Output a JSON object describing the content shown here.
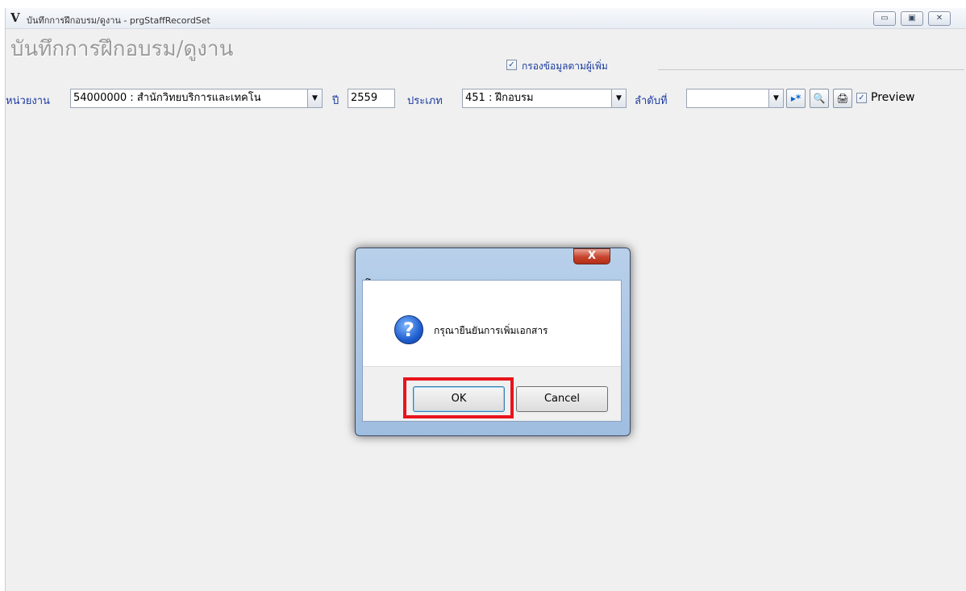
{
  "window": {
    "title": "บันทึกการฝึกอบรม/ดูงาน - prgStaffRecordSet",
    "app_icon_glyph": "V",
    "minimize_glyph": "▭",
    "maximize_glyph": "▣",
    "close_glyph": "✕"
  },
  "page": {
    "heading": "บันทึกการฝึกอบรม/ดูงาน",
    "filter_label": "กรองข้อมูลตามผู้เพิ่ม",
    "filter_checked": true
  },
  "toolbar": {
    "unit_label": "หน่วยงาน",
    "unit_value": "54000000 : สำนักวิทยบริการและเทคโน",
    "year_label": "ปี",
    "year_value": "2559",
    "type_label": "ประเภท",
    "type_value": "451 : ฝึกอบรม",
    "seq_label": "ลำดับที่",
    "seq_value": "",
    "new_record_glyph": "▸*",
    "find_glyph": "🔍",
    "print_glyph": "🖨",
    "preview_label": "Preview",
    "preview_checked": true
  },
  "dialog": {
    "title": "โปรดระบุ",
    "message": "กรุณายืนยันการเพิ่มเอกสาร",
    "icon_glyph": "?",
    "close_glyph": "X",
    "ok_label": "OK",
    "cancel_label": "Cancel"
  },
  "colors": {
    "label_blue": "#1a3aa0",
    "highlight_red": "#e8141b"
  }
}
